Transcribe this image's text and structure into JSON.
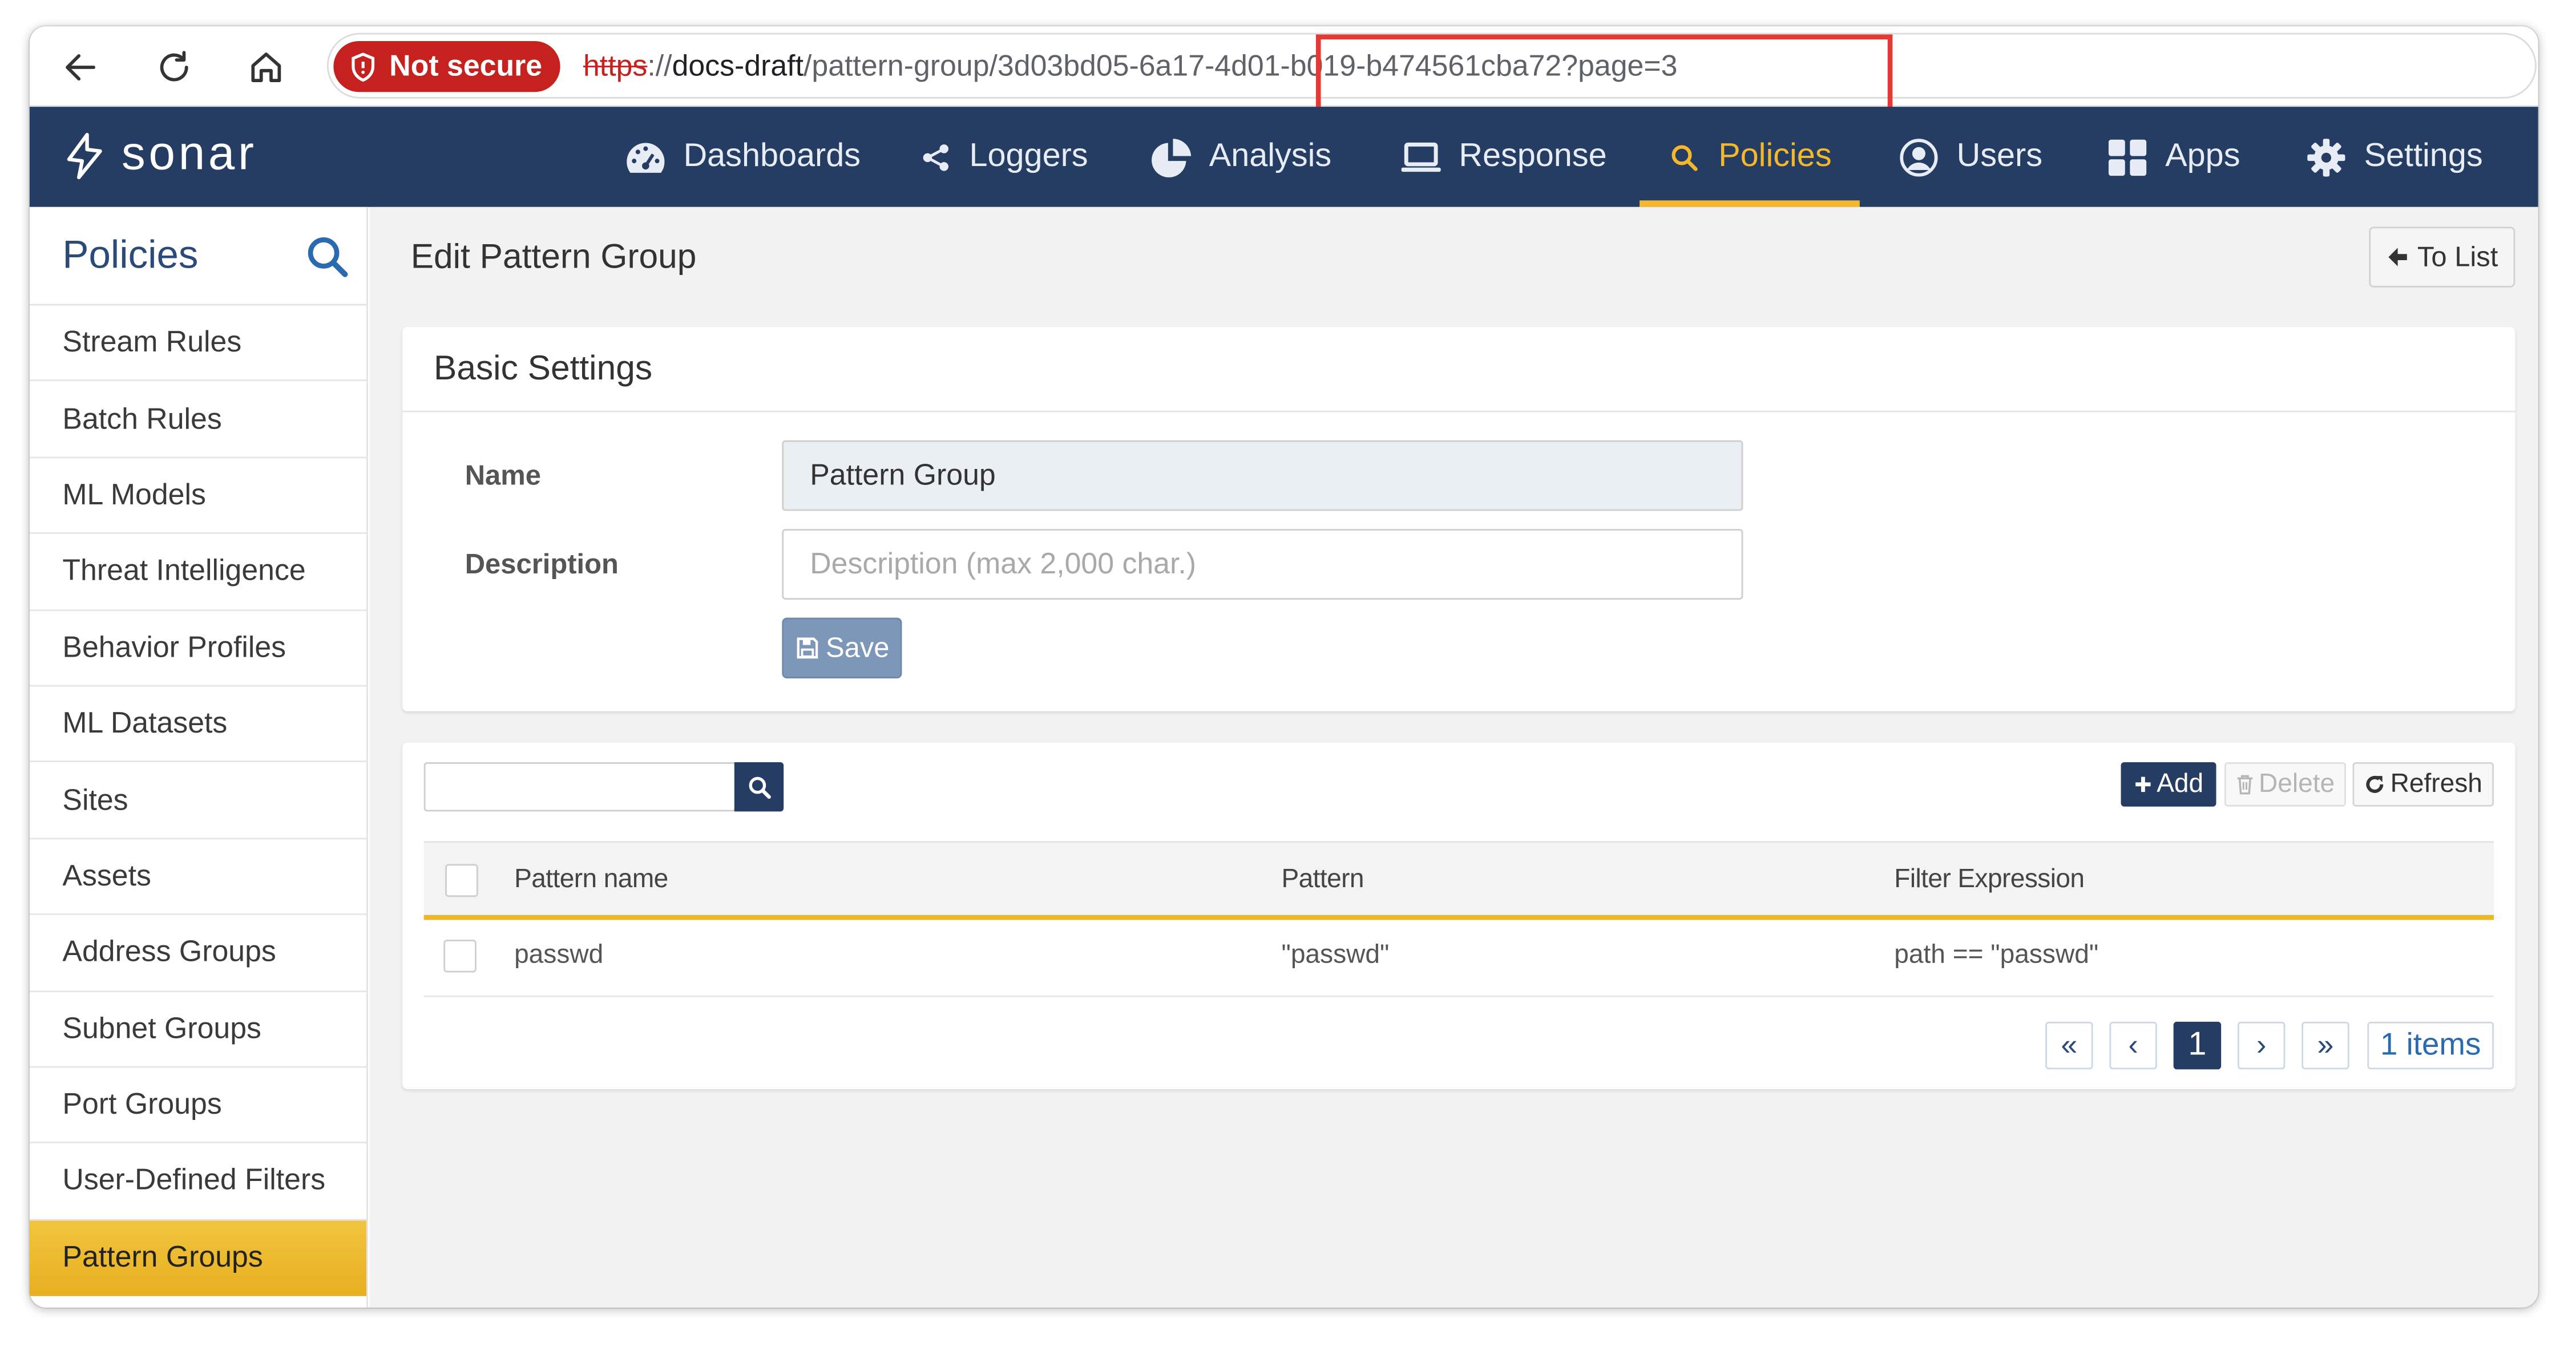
{
  "browser": {
    "security_label": "Not secure",
    "url": {
      "protocol": "https",
      "separator": "://",
      "host": "docs-draft",
      "path": "/pattern-group/",
      "id": "3d03bd05-6a17-4d01-b019-b474561cba72",
      "query": "?page=3"
    },
    "icons": [
      "back-arrow-icon",
      "reload-icon",
      "home-icon",
      "shield-icon"
    ]
  },
  "header": {
    "brand": "sonar",
    "nav": [
      {
        "label": "Dashboards",
        "icon": "gauge-icon"
      },
      {
        "label": "Loggers",
        "icon": "share-icon"
      },
      {
        "label": "Analysis",
        "icon": "pie-chart-icon"
      },
      {
        "label": "Response",
        "icon": "laptop-icon"
      },
      {
        "label": "Policies",
        "icon": "search-icon",
        "active": true
      },
      {
        "label": "Users",
        "icon": "user-circle-icon"
      },
      {
        "label": "Apps",
        "icon": "grid-icon"
      },
      {
        "label": "Settings",
        "icon": "gear-icon"
      }
    ],
    "active_color": "#f6b82b",
    "bg_color": "#253d63"
  },
  "sidebar": {
    "title": "Policies",
    "items": [
      {
        "label": "Stream Rules"
      },
      {
        "label": "Batch Rules"
      },
      {
        "label": "ML Models"
      },
      {
        "label": "Threat Intelligence"
      },
      {
        "label": "Behavior Profiles"
      },
      {
        "label": "ML Datasets"
      },
      {
        "label": "Sites"
      },
      {
        "label": "Assets"
      },
      {
        "label": "Address Groups"
      },
      {
        "label": "Subnet Groups"
      },
      {
        "label": "Port Groups"
      },
      {
        "label": "User-Defined Filters"
      },
      {
        "label": "Pattern Groups",
        "active": true
      }
    ]
  },
  "main": {
    "title": "Edit Pattern Group",
    "to_list_label": "To List",
    "basic_settings": {
      "title": "Basic Settings",
      "name_label": "Name",
      "name_value": "Pattern Group",
      "description_label": "Description",
      "description_value": "",
      "description_placeholder": "Description (max 2,000 char.)",
      "save_label": "Save"
    },
    "table": {
      "search_value": "",
      "add_label": "Add",
      "delete_label": "Delete",
      "refresh_label": "Refresh",
      "columns": [
        "Pattern name",
        "Pattern",
        "Filter Expression"
      ],
      "rows": [
        {
          "pattern_name": "passwd",
          "pattern": "\"passwd\"",
          "filter_expression": "path == \"passwd\""
        }
      ],
      "pagination": {
        "first": "«",
        "prev": "‹",
        "current": "1",
        "next": "›",
        "last": "»",
        "total": "1 items"
      }
    }
  }
}
